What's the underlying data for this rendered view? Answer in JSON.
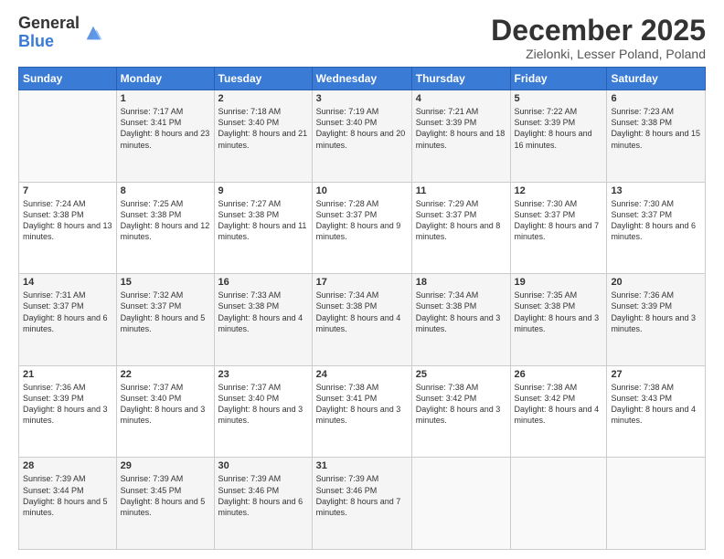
{
  "logo": {
    "general": "General",
    "blue": "Blue"
  },
  "title": "December 2025",
  "subtitle": "Zielonki, Lesser Poland, Poland",
  "days_header": [
    "Sunday",
    "Monday",
    "Tuesday",
    "Wednesday",
    "Thursday",
    "Friday",
    "Saturday"
  ],
  "weeks": [
    [
      {
        "day": "",
        "sunrise": "",
        "sunset": "",
        "daylight": ""
      },
      {
        "day": "1",
        "sunrise": "Sunrise: 7:17 AM",
        "sunset": "Sunset: 3:41 PM",
        "daylight": "Daylight: 8 hours and 23 minutes."
      },
      {
        "day": "2",
        "sunrise": "Sunrise: 7:18 AM",
        "sunset": "Sunset: 3:40 PM",
        "daylight": "Daylight: 8 hours and 21 minutes."
      },
      {
        "day": "3",
        "sunrise": "Sunrise: 7:19 AM",
        "sunset": "Sunset: 3:40 PM",
        "daylight": "Daylight: 8 hours and 20 minutes."
      },
      {
        "day": "4",
        "sunrise": "Sunrise: 7:21 AM",
        "sunset": "Sunset: 3:39 PM",
        "daylight": "Daylight: 8 hours and 18 minutes."
      },
      {
        "day": "5",
        "sunrise": "Sunrise: 7:22 AM",
        "sunset": "Sunset: 3:39 PM",
        "daylight": "Daylight: 8 hours and 16 minutes."
      },
      {
        "day": "6",
        "sunrise": "Sunrise: 7:23 AM",
        "sunset": "Sunset: 3:38 PM",
        "daylight": "Daylight: 8 hours and 15 minutes."
      }
    ],
    [
      {
        "day": "7",
        "sunrise": "Sunrise: 7:24 AM",
        "sunset": "Sunset: 3:38 PM",
        "daylight": "Daylight: 8 hours and 13 minutes."
      },
      {
        "day": "8",
        "sunrise": "Sunrise: 7:25 AM",
        "sunset": "Sunset: 3:38 PM",
        "daylight": "Daylight: 8 hours and 12 minutes."
      },
      {
        "day": "9",
        "sunrise": "Sunrise: 7:27 AM",
        "sunset": "Sunset: 3:38 PM",
        "daylight": "Daylight: 8 hours and 11 minutes."
      },
      {
        "day": "10",
        "sunrise": "Sunrise: 7:28 AM",
        "sunset": "Sunset: 3:37 PM",
        "daylight": "Daylight: 8 hours and 9 minutes."
      },
      {
        "day": "11",
        "sunrise": "Sunrise: 7:29 AM",
        "sunset": "Sunset: 3:37 PM",
        "daylight": "Daylight: 8 hours and 8 minutes."
      },
      {
        "day": "12",
        "sunrise": "Sunrise: 7:30 AM",
        "sunset": "Sunset: 3:37 PM",
        "daylight": "Daylight: 8 hours and 7 minutes."
      },
      {
        "day": "13",
        "sunrise": "Sunrise: 7:30 AM",
        "sunset": "Sunset: 3:37 PM",
        "daylight": "Daylight: 8 hours and 6 minutes."
      }
    ],
    [
      {
        "day": "14",
        "sunrise": "Sunrise: 7:31 AM",
        "sunset": "Sunset: 3:37 PM",
        "daylight": "Daylight: 8 hours and 6 minutes."
      },
      {
        "day": "15",
        "sunrise": "Sunrise: 7:32 AM",
        "sunset": "Sunset: 3:37 PM",
        "daylight": "Daylight: 8 hours and 5 minutes."
      },
      {
        "day": "16",
        "sunrise": "Sunrise: 7:33 AM",
        "sunset": "Sunset: 3:38 PM",
        "daylight": "Daylight: 8 hours and 4 minutes."
      },
      {
        "day": "17",
        "sunrise": "Sunrise: 7:34 AM",
        "sunset": "Sunset: 3:38 PM",
        "daylight": "Daylight: 8 hours and 4 minutes."
      },
      {
        "day": "18",
        "sunrise": "Sunrise: 7:34 AM",
        "sunset": "Sunset: 3:38 PM",
        "daylight": "Daylight: 8 hours and 3 minutes."
      },
      {
        "day": "19",
        "sunrise": "Sunrise: 7:35 AM",
        "sunset": "Sunset: 3:38 PM",
        "daylight": "Daylight: 8 hours and 3 minutes."
      },
      {
        "day": "20",
        "sunrise": "Sunrise: 7:36 AM",
        "sunset": "Sunset: 3:39 PM",
        "daylight": "Daylight: 8 hours and 3 minutes."
      }
    ],
    [
      {
        "day": "21",
        "sunrise": "Sunrise: 7:36 AM",
        "sunset": "Sunset: 3:39 PM",
        "daylight": "Daylight: 8 hours and 3 minutes."
      },
      {
        "day": "22",
        "sunrise": "Sunrise: 7:37 AM",
        "sunset": "Sunset: 3:40 PM",
        "daylight": "Daylight: 8 hours and 3 minutes."
      },
      {
        "day": "23",
        "sunrise": "Sunrise: 7:37 AM",
        "sunset": "Sunset: 3:40 PM",
        "daylight": "Daylight: 8 hours and 3 minutes."
      },
      {
        "day": "24",
        "sunrise": "Sunrise: 7:38 AM",
        "sunset": "Sunset: 3:41 PM",
        "daylight": "Daylight: 8 hours and 3 minutes."
      },
      {
        "day": "25",
        "sunrise": "Sunrise: 7:38 AM",
        "sunset": "Sunset: 3:42 PM",
        "daylight": "Daylight: 8 hours and 3 minutes."
      },
      {
        "day": "26",
        "sunrise": "Sunrise: 7:38 AM",
        "sunset": "Sunset: 3:42 PM",
        "daylight": "Daylight: 8 hours and 4 minutes."
      },
      {
        "day": "27",
        "sunrise": "Sunrise: 7:38 AM",
        "sunset": "Sunset: 3:43 PM",
        "daylight": "Daylight: 8 hours and 4 minutes."
      }
    ],
    [
      {
        "day": "28",
        "sunrise": "Sunrise: 7:39 AM",
        "sunset": "Sunset: 3:44 PM",
        "daylight": "Daylight: 8 hours and 5 minutes."
      },
      {
        "day": "29",
        "sunrise": "Sunrise: 7:39 AM",
        "sunset": "Sunset: 3:45 PM",
        "daylight": "Daylight: 8 hours and 5 minutes."
      },
      {
        "day": "30",
        "sunrise": "Sunrise: 7:39 AM",
        "sunset": "Sunset: 3:46 PM",
        "daylight": "Daylight: 8 hours and 6 minutes."
      },
      {
        "day": "31",
        "sunrise": "Sunrise: 7:39 AM",
        "sunset": "Sunset: 3:46 PM",
        "daylight": "Daylight: 8 hours and 7 minutes."
      },
      {
        "day": "",
        "sunrise": "",
        "sunset": "",
        "daylight": ""
      },
      {
        "day": "",
        "sunrise": "",
        "sunset": "",
        "daylight": ""
      },
      {
        "day": "",
        "sunrise": "",
        "sunset": "",
        "daylight": ""
      }
    ]
  ]
}
